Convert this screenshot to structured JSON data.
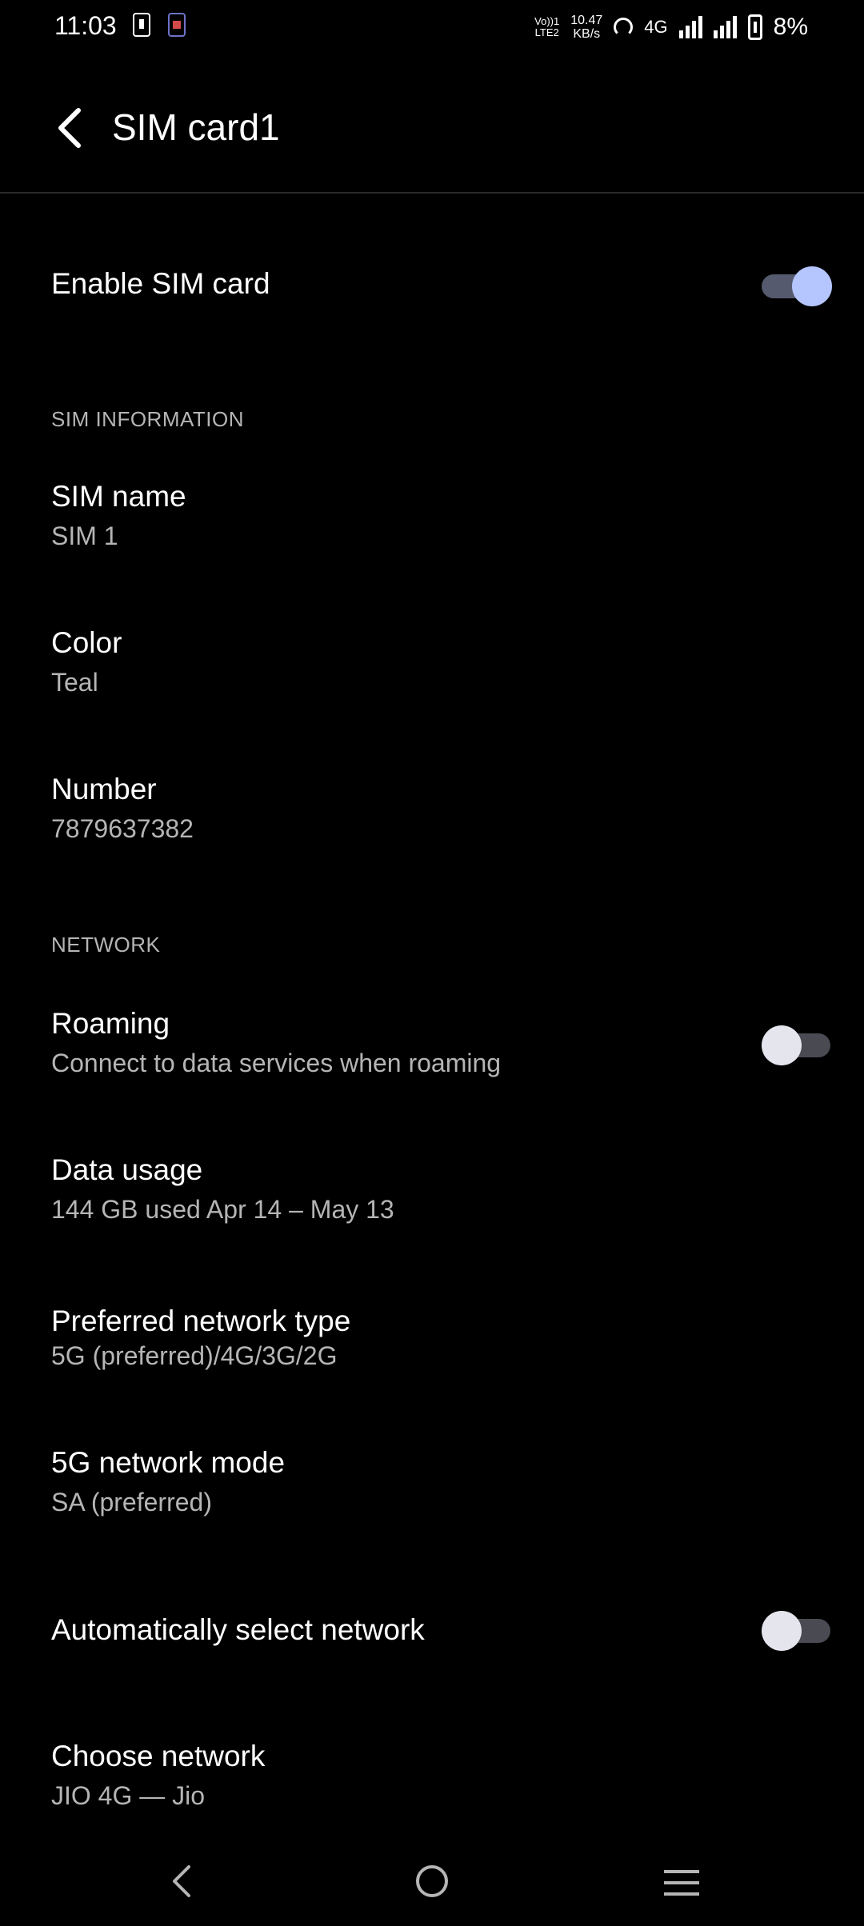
{
  "status_bar": {
    "time": "11:03",
    "volte_top": "Vo))1",
    "volte_bottom": "LTE2",
    "speed_value": "10.47",
    "speed_unit": "KB/s",
    "network": "4G",
    "battery": "8%"
  },
  "app_bar": {
    "title": "SIM card1"
  },
  "enable_sim": {
    "label": "Enable SIM card",
    "enabled": true
  },
  "sim_info": {
    "header": "SIM INFORMATION",
    "name_label": "SIM name",
    "name_value": "SIM 1",
    "color_label": "Color",
    "color_value": "Teal",
    "number_label": "Number",
    "number_value": "7879637382"
  },
  "network": {
    "header": "NETWORK",
    "roaming_label": "Roaming",
    "roaming_sub": "Connect to data services when roaming",
    "roaming_enabled": false,
    "data_usage_label": "Data usage",
    "data_usage_value": "144 GB used Apr 14 – May 13",
    "preferred_type_label": "Preferred network type",
    "preferred_type_value": "5G (preferred)/4G/3G/2G",
    "mode_5g_label": "5G network mode",
    "mode_5g_value": "SA (preferred)",
    "auto_select_label": "Automatically select network",
    "auto_select_enabled": false,
    "choose_label": "Choose network",
    "choose_value": "JIO 4G — Jio"
  },
  "colors": {
    "background": "#000000",
    "accent": "#b5c6ff",
    "secondary_text": "#b5b5b5"
  }
}
